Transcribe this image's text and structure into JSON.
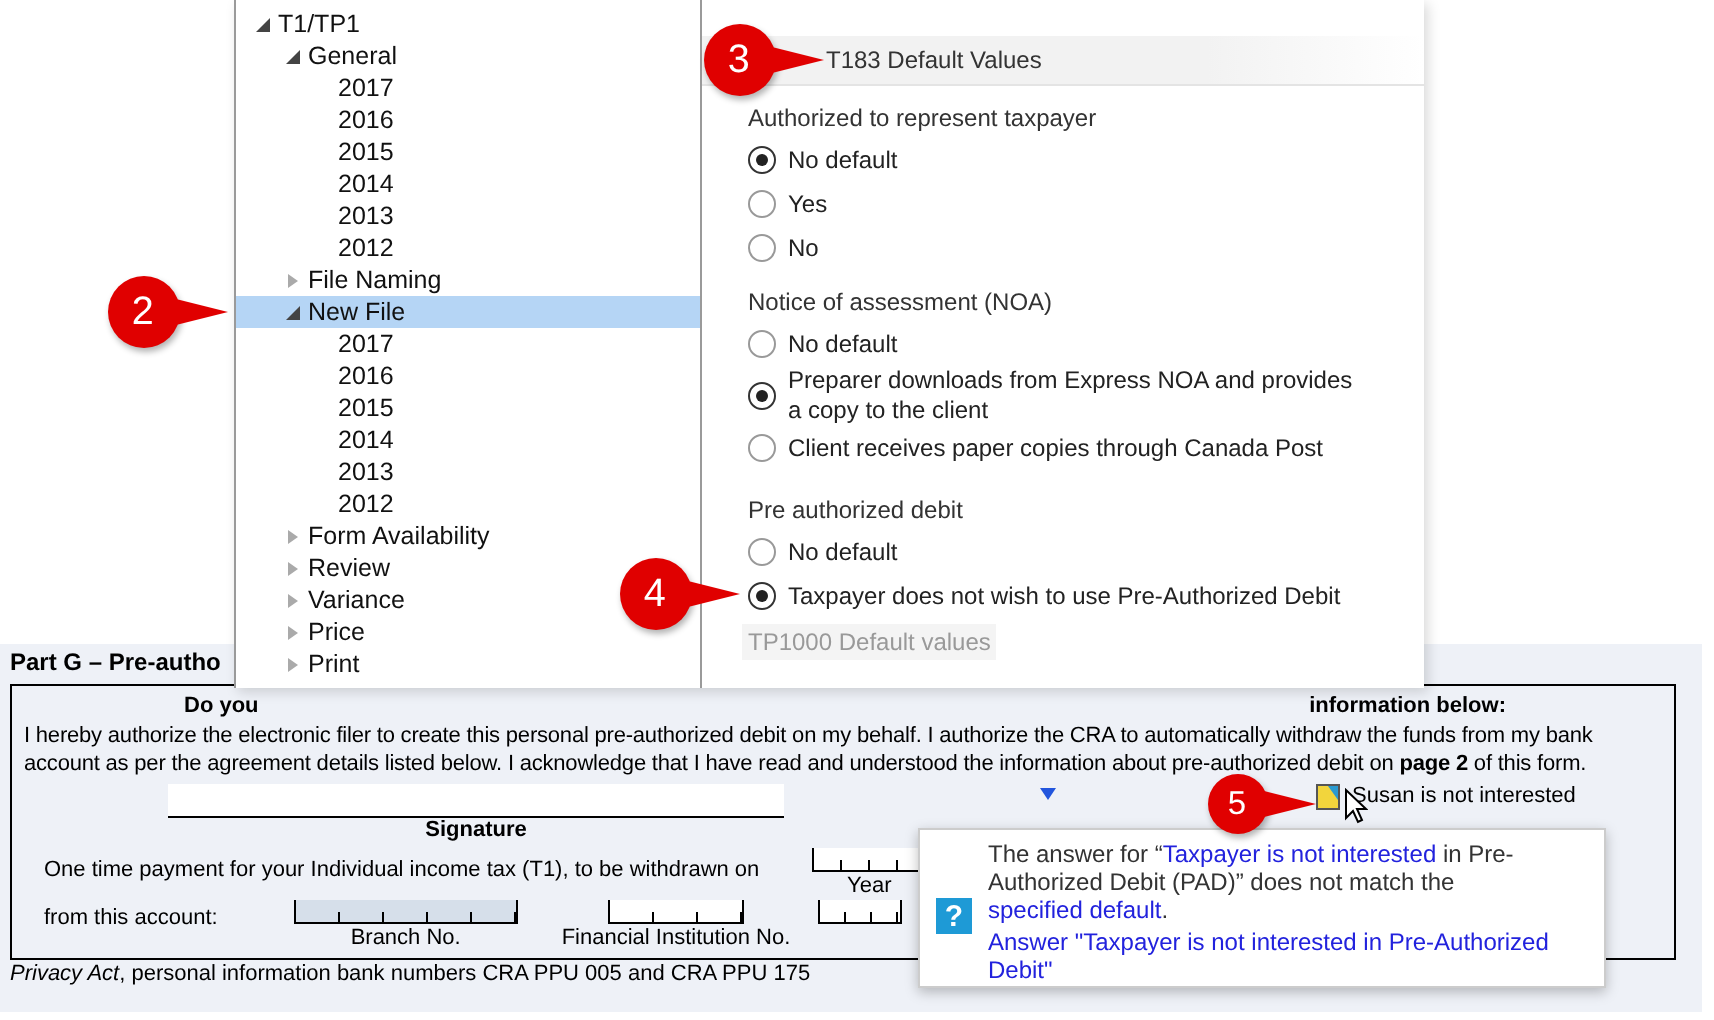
{
  "tree": [
    {
      "label": "T1/TP1",
      "expanded": true,
      "selected": false,
      "children": [
        {
          "label": "General",
          "expanded": true,
          "selected": false,
          "children": [
            {
              "label": "2017",
              "selected": false
            },
            {
              "label": "2016",
              "selected": false
            },
            {
              "label": "2015",
              "selected": false
            },
            {
              "label": "2014",
              "selected": false
            },
            {
              "label": "2013",
              "selected": false
            },
            {
              "label": "2012",
              "selected": false
            }
          ]
        },
        {
          "label": "File Naming",
          "expanded": false,
          "selected": false
        },
        {
          "label": "New File",
          "expanded": true,
          "selected": true,
          "children": [
            {
              "label": "2017",
              "selected": false
            },
            {
              "label": "2016",
              "selected": false
            },
            {
              "label": "2015",
              "selected": false
            },
            {
              "label": "2014",
              "selected": false
            },
            {
              "label": "2013",
              "selected": false
            },
            {
              "label": "2012",
              "selected": false
            }
          ]
        },
        {
          "label": "Form Availability",
          "expanded": false,
          "selected": false
        },
        {
          "label": "Review",
          "expanded": false,
          "selected": false
        },
        {
          "label": "Variance",
          "expanded": false,
          "selected": false
        },
        {
          "label": "Price",
          "expanded": false,
          "selected": false
        },
        {
          "label": "Print",
          "expanded": false,
          "selected": false
        }
      ]
    }
  ],
  "defaults": {
    "title": "T183 Default Values",
    "groups": [
      {
        "label": "Authorized to represent taxpayer",
        "options": [
          {
            "label": "No default",
            "selected": true
          },
          {
            "label": "Yes",
            "selected": false
          },
          {
            "label": "No",
            "selected": false
          }
        ]
      },
      {
        "label": "Notice of assessment (NOA)",
        "options": [
          {
            "label": "No default",
            "selected": false
          },
          {
            "label": "Preparer downloads from Express NOA and provides a copy to the client",
            "selected": true
          },
          {
            "label": "Client receives paper copies through Canada Post",
            "selected": false
          }
        ]
      },
      {
        "label": "Pre authorized debit",
        "options": [
          {
            "label": "No default",
            "selected": false
          },
          {
            "label": "Taxpayer does not wish to use Pre-Authorized Debit",
            "selected": true
          }
        ]
      }
    ],
    "next_section": "TP1000 Default values"
  },
  "form": {
    "heading": "Part G – Pre-autho",
    "question_start": "Do you",
    "question_end": "information below:",
    "paragraph": "I hereby authorize the electronic filer to create this personal pre-authorized debit on my behalf. I authorize the CRA to automatically withdraw the funds from my bank account as per the agreement details listed below. I acknowledge that I have read and understood the information about pre-authorized debit on **page 2** of this form.",
    "signature_label": "Signature",
    "status_note": "Susan is not interested",
    "payment_text": "One time payment for your Individual income tax (T1), to be withdrawn on",
    "year_label": "Year",
    "account_text": "from this account:",
    "branch_label": "Branch No.",
    "institution_label": "Financial Institution No.",
    "footer": "*Privacy Act*, personal information bank numbers CRA PPU 005 and CRA PPU 175"
  },
  "tooltip": {
    "icon": "?",
    "message": [
      {
        "kind": "text",
        "text": "The answer for “"
      },
      {
        "kind": "link",
        "text": "Taxpayer is not interested"
      },
      {
        "kind": "text",
        "text": " in Pre-Authorized Debit (PAD)” does not match the "
      },
      {
        "kind": "link",
        "text": "specified default"
      },
      {
        "kind": "text",
        "text": "."
      }
    ],
    "action": "Answer \"Taxpayer is not interested in Pre-Authorized Debit\""
  },
  "callouts": [
    {
      "label": "2"
    },
    {
      "label": "3"
    },
    {
      "label": "4"
    },
    {
      "label": "5"
    }
  ]
}
